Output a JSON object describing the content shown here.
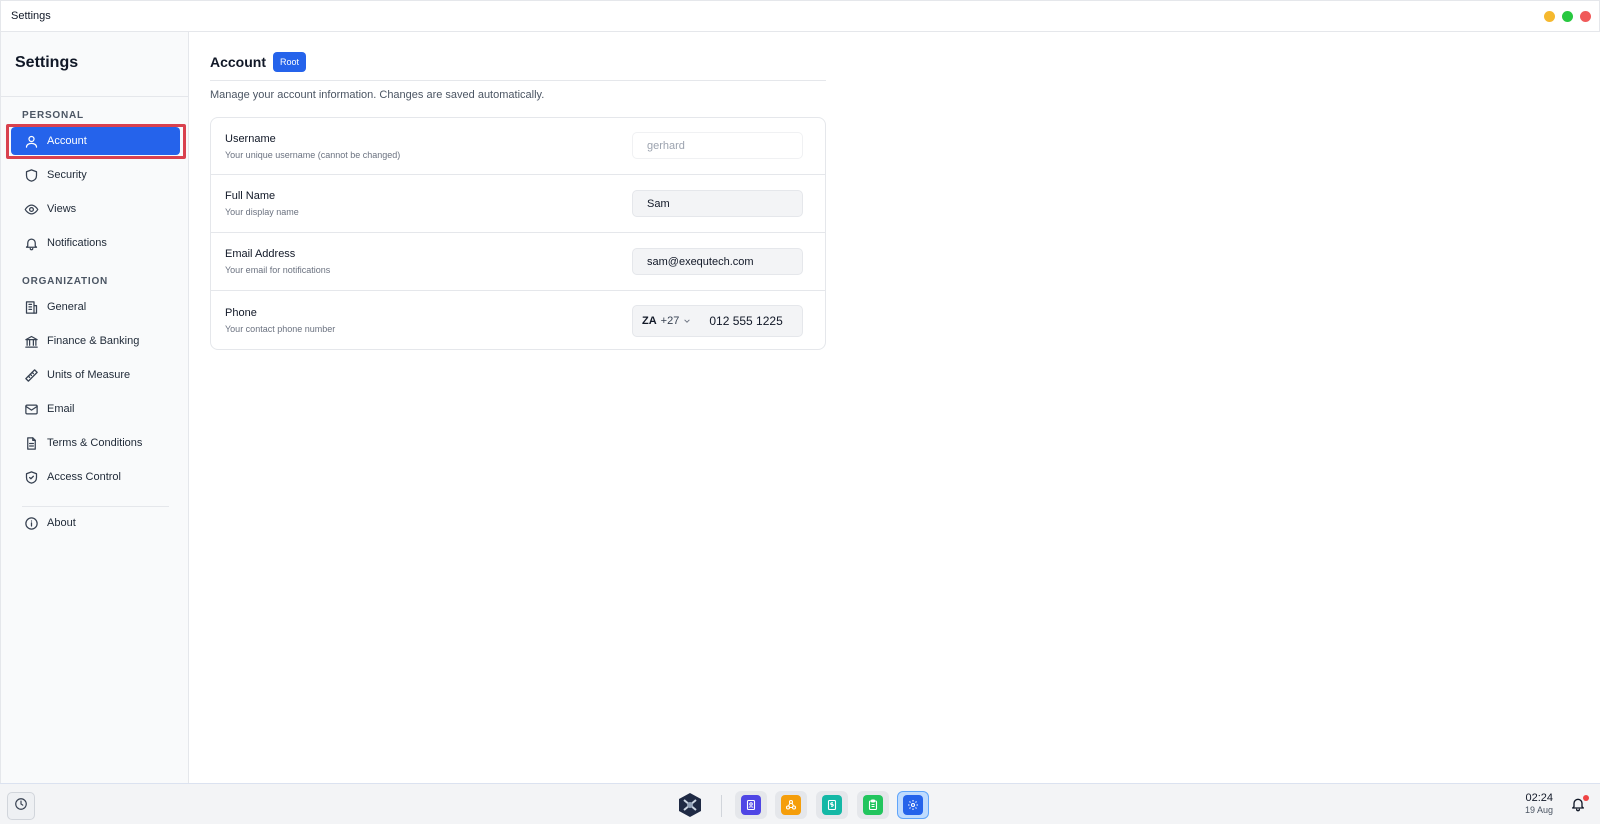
{
  "window": {
    "title": "Settings",
    "controls": {
      "minimize_color": "#f5b82e",
      "maximize_color": "#28c840",
      "close_color": "#f05a5a"
    }
  },
  "sidebar": {
    "title": "Settings",
    "sections": [
      {
        "label": "PERSONAL",
        "items": [
          {
            "label": "Account",
            "icon": "user-icon",
            "active": true
          },
          {
            "label": "Security",
            "icon": "shield-icon"
          },
          {
            "label": "Views",
            "icon": "eye-icon"
          },
          {
            "label": "Notifications",
            "icon": "bell-icon"
          }
        ]
      },
      {
        "label": "ORGANIZATION",
        "items": [
          {
            "label": "General",
            "icon": "building-icon"
          },
          {
            "label": "Finance & Banking",
            "icon": "bank-icon"
          },
          {
            "label": "Units of Measure",
            "icon": "ruler-icon"
          },
          {
            "label": "Email",
            "icon": "mail-icon"
          },
          {
            "label": "Terms & Conditions",
            "icon": "document-icon"
          },
          {
            "label": "Access Control",
            "icon": "shield-check-icon"
          }
        ]
      }
    ],
    "footer_items": [
      {
        "label": "About",
        "icon": "info-icon"
      }
    ]
  },
  "main": {
    "title": "Account",
    "badge": "Root",
    "description": "Manage your account information. Changes are saved automatically.",
    "fields": [
      {
        "label": "Username",
        "description": "Your unique username (cannot be changed)",
        "value": "gerhard",
        "readonly": true
      },
      {
        "label": "Full Name",
        "description": "Your display name",
        "value": "Sam"
      },
      {
        "label": "Email Address",
        "description": "Your email for notifications",
        "value": "sam@exequtech.com"
      },
      {
        "label": "Phone",
        "description": "Your contact phone number",
        "country_code": "ZA",
        "dial_code": "+27",
        "value": "012 555 1225"
      }
    ]
  },
  "taskbar": {
    "time": "02:24",
    "date": "19 Aug",
    "apps": [
      {
        "icon": "contacts-app-icon",
        "color": "#4f46e5"
      },
      {
        "icon": "network-app-icon",
        "color": "#f59e0b"
      },
      {
        "icon": "invoice-app-icon",
        "color": "#14b8a6"
      },
      {
        "icon": "clipboard-app-icon",
        "color": "#22c55e"
      },
      {
        "icon": "settings-app-icon",
        "color": "#2563eb",
        "active": true
      }
    ],
    "accent": "#2563eb"
  }
}
